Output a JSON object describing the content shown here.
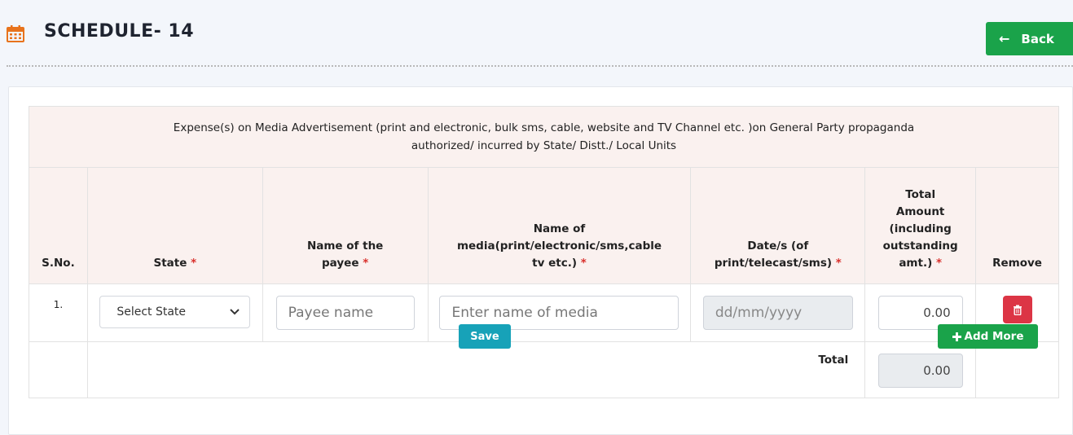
{
  "header": {
    "title": "SCHEDULE- 14",
    "back_label": "Back"
  },
  "table": {
    "caption_line1": "Expense(s) on Media Advertisement (print and electronic, bulk sms, cable, website and TV Channel etc. )on General Party propaganda",
    "caption_line2": "authorized/ incurred by State/ Distt./ Local Units",
    "columns": {
      "sno": "S.No.",
      "state": "State",
      "payee_l1": "Name of the",
      "payee_l2": "payee",
      "media_l1": "Name of",
      "media_l2": "media(print/electronic/sms,cable",
      "media_l3": "tv etc.)",
      "date_l1": "Date/s (of",
      "date_l2": "print/telecast/sms)",
      "amt_l1": "Total",
      "amt_l2": "Amount",
      "amt_l3": "(including",
      "amt_l4": "outstanding",
      "amt_l5": "amt.)",
      "remove": "Remove"
    },
    "required_mark": "*",
    "row": {
      "sno": "1.",
      "state_selected": "Select State",
      "payee_placeholder": "Payee name",
      "media_placeholder": "Enter name of media",
      "date_placeholder": "dd/mm/yyyy",
      "amount": "0.00"
    },
    "total_label": "Total",
    "total_value": "0.00"
  },
  "actions": {
    "save_label": "Save",
    "add_more_label": "Add More"
  },
  "icons": {
    "title": "calendar-icon",
    "back": "arrow-left-icon",
    "select": "chevron-down-icon",
    "remove": "trash-icon",
    "add": "plus-icon"
  },
  "colors": {
    "accent_green": "#1aa34a",
    "danger_red": "#dc3545",
    "info_teal": "#17a2b8",
    "icon_orange": "#e8731c"
  }
}
